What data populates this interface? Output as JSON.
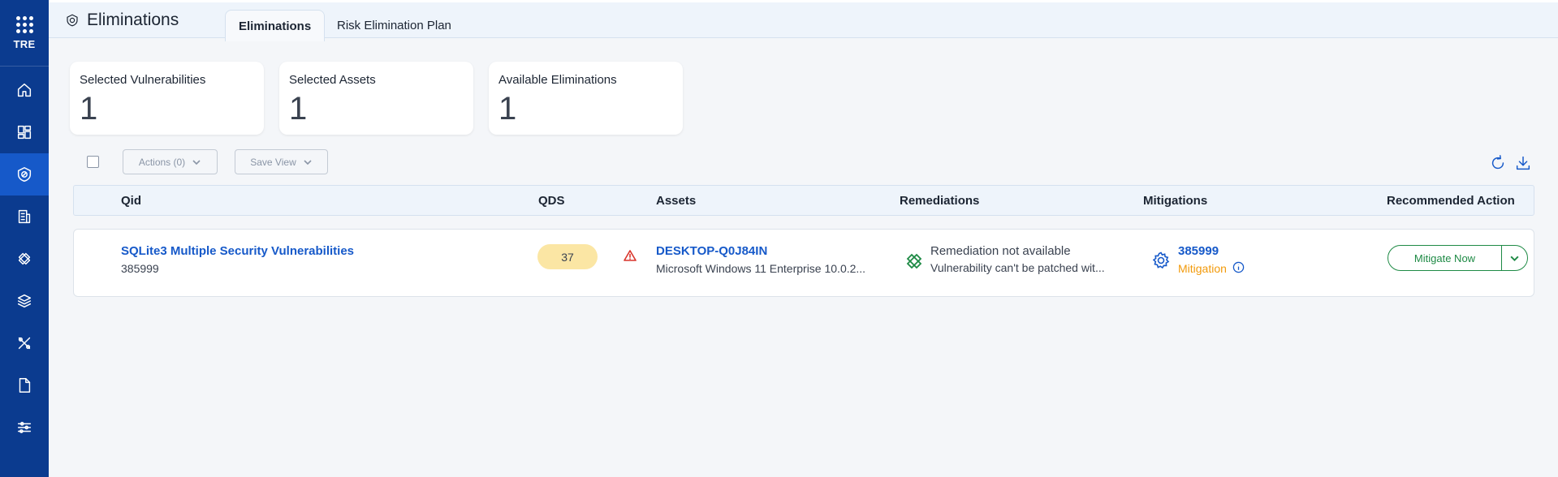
{
  "sidebar": {
    "brand_label": "TRE",
    "items": [
      {
        "icon": "home-icon"
      },
      {
        "icon": "dashboard-icon"
      },
      {
        "icon": "eliminations-icon",
        "active": true
      },
      {
        "icon": "reports-icon"
      },
      {
        "icon": "patch-icon"
      },
      {
        "icon": "layers-icon"
      },
      {
        "icon": "tools-icon"
      },
      {
        "icon": "document-icon"
      },
      {
        "icon": "settings-sliders-icon"
      }
    ]
  },
  "header": {
    "title": "Eliminations",
    "tabs": [
      {
        "label": "Eliminations",
        "active": true
      },
      {
        "label": "Risk Elimination Plan",
        "active": false
      }
    ]
  },
  "stats": [
    {
      "label": "Selected Vulnerabilities",
      "value": "1"
    },
    {
      "label": "Selected Assets",
      "value": "1"
    },
    {
      "label": "Available Eliminations",
      "value": "1"
    }
  ],
  "toolbar": {
    "actions_label": "Actions (0)",
    "save_view_label": "Save View"
  },
  "table": {
    "columns": [
      "Qid",
      "QDS",
      "Assets",
      "Remediations",
      "Mitigations",
      "Recommended Action"
    ],
    "rows": [
      {
        "qid_title": "SQLite3 Multiple Security Vulnerabilities",
        "qid": "385999",
        "qds": "37",
        "asset_name": "DESKTOP-Q0J84IN",
        "asset_os": "Microsoft Windows 11 Enterprise 10.0.2...",
        "remediation_status": "Remediation not available",
        "remediation_detail": "Vulnerability can't be patched wit...",
        "mitigation_id": "385999",
        "mitigation_label": "Mitigation",
        "action_label": "Mitigate Now"
      }
    ]
  },
  "colors": {
    "sidebar": "#0b3b8f",
    "sidebar_active": "#1659c9",
    "link": "#1659c9",
    "qds_badge": "#fbe6a4",
    "mitigation_label": "#f29a0b",
    "action_green": "#1e8a45"
  }
}
